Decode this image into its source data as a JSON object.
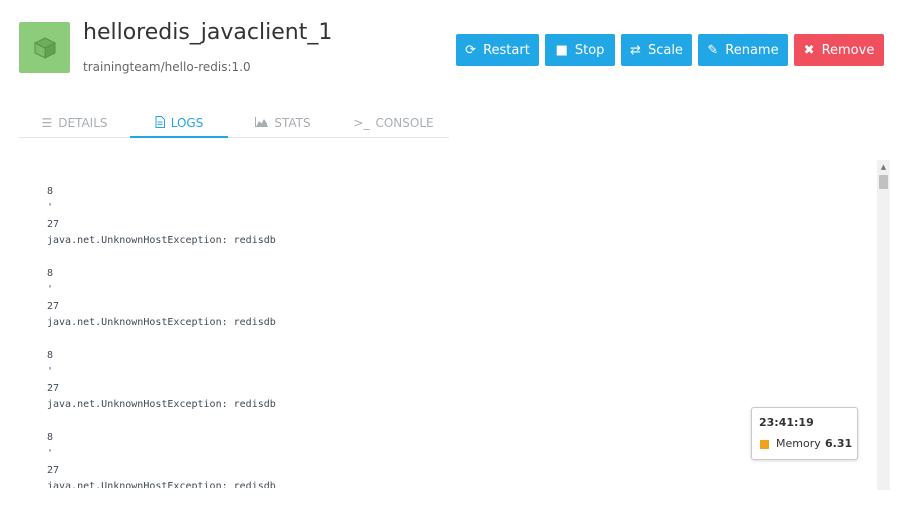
{
  "container": {
    "name": "helloredis_javaclient_1",
    "image": "trainingteam/hello-redis:1.0",
    "icon": "cube-icon",
    "icon_color": "#8ccc7a"
  },
  "actions": {
    "restart_label": "Restart",
    "stop_label": "Stop",
    "scale_label": "Scale",
    "rename_label": "Rename",
    "remove_label": "Remove",
    "primary_color": "#21a6e6",
    "danger_color": "#f0505d"
  },
  "tabs": [
    {
      "label": "DETAILS",
      "icon": "list-icon",
      "active": false
    },
    {
      "label": "LOGS",
      "icon": "document-icon",
      "active": true
    },
    {
      "label": "STATS",
      "icon": "area-chart-icon",
      "active": false
    },
    {
      "label": "CONSOLE",
      "icon": "terminal-icon",
      "active": false
    }
  ],
  "logs": [
    {
      "a": "8",
      "b": "'",
      "c": "27",
      "d": "java.net.UnknownHostException: redisdb"
    },
    {
      "a": "8",
      "b": "'",
      "c": "27",
      "d": "java.net.UnknownHostException: redisdb"
    },
    {
      "a": "8",
      "b": "'",
      "c": "27",
      "d": "java.net.UnknownHostException: redisdb"
    },
    {
      "a": "8",
      "b": "'",
      "c": "27",
      "d": "java.net.UnknownHostException: redisdb"
    }
  ],
  "tooltip": {
    "time": "23:41:19",
    "series": "Memory",
    "value": "6.31",
    "swatch_color": "#f0a11e"
  }
}
